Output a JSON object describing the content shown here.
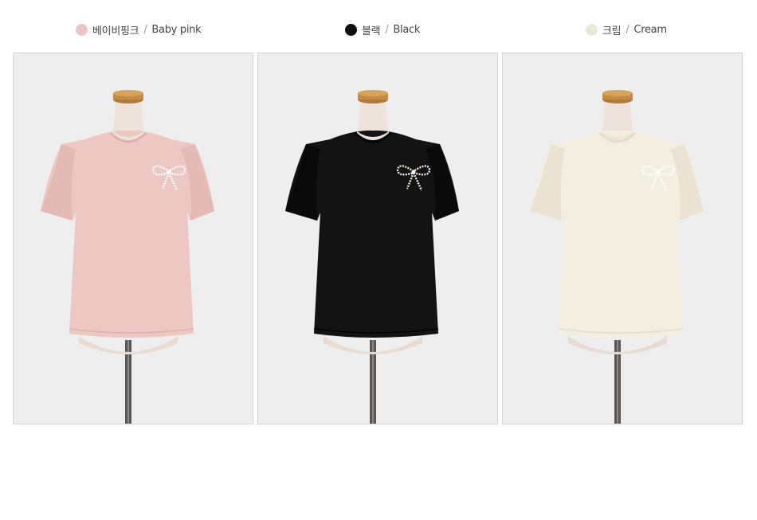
{
  "colors": [
    {
      "name_ko": "베이비핑크",
      "separator": "/",
      "name_en": "Baby pink",
      "swatch": "#e8c6c3",
      "fabric": "#edc8c3",
      "shade": "#deb1ab"
    },
    {
      "name_ko": "블랙",
      "separator": "/",
      "name_en": "Black",
      "swatch": "#0e0e0e",
      "fabric": "#131313",
      "shade": "#050505"
    },
    {
      "name_ko": "크림",
      "separator": "/",
      "name_en": "Cream",
      "swatch": "#ebe7d8",
      "fabric": "#f3eee0",
      "shade": "#e4dccb"
    }
  ]
}
